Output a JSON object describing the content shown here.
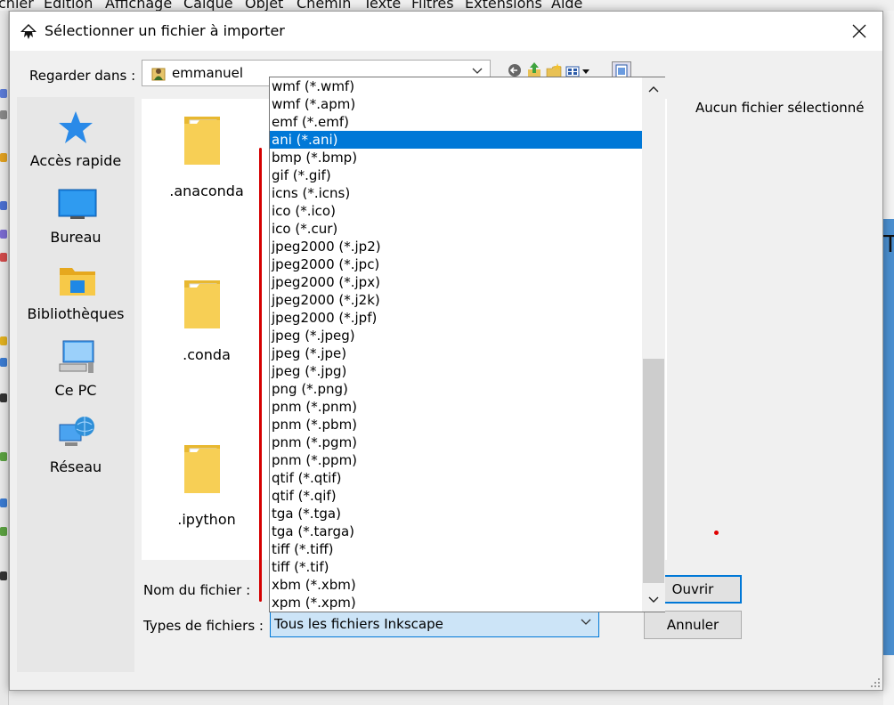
{
  "background_app": {
    "menu": [
      "chier",
      "Édition",
      "Affichage",
      "Calque",
      "Objet",
      "Chemin",
      "Texte",
      "Filtres",
      "Extensions",
      "Aide"
    ],
    "canvas_glyph": "T"
  },
  "dialog": {
    "title": "Sélectionner un fichier à importer",
    "look_in_label": "Regarder dans :",
    "look_in_value": "emmanuel",
    "places": [
      {
        "label": "Accès rapide",
        "icon": "star-icon"
      },
      {
        "label": "Bureau",
        "icon": "desktop-icon"
      },
      {
        "label": "Bibliothèques",
        "icon": "libraries-icon"
      },
      {
        "label": "Ce PC",
        "icon": "computer-icon"
      },
      {
        "label": "Réseau",
        "icon": "network-icon"
      }
    ],
    "folders": [
      ".anaconda",
      ".conda",
      ".ipython"
    ],
    "no_file_selected": "Aucun fichier sélectionné",
    "file_name_label": "Nom du fichier :",
    "file_types_label": "Types de fichiers :",
    "file_types_value": "Tous les fichiers Inkscape",
    "open_button": "Ouvrir",
    "cancel_button": "Annuler",
    "nav_icons": [
      "back-icon",
      "up-folder-icon",
      "new-folder-icon",
      "view-menu-icon",
      "preview-icon"
    ]
  },
  "file_type_dropdown": {
    "selected_index": 3,
    "items": [
      "wmf (*.wmf)",
      "wmf (*.apm)",
      "emf (*.emf)",
      "ani (*.ani)",
      "bmp (*.bmp)",
      "gif (*.gif)",
      "icns (*.icns)",
      "ico (*.ico)",
      "ico (*.cur)",
      "jpeg2000 (*.jp2)",
      "jpeg2000 (*.jpc)",
      "jpeg2000 (*.jpx)",
      "jpeg2000 (*.j2k)",
      "jpeg2000 (*.jpf)",
      "jpeg (*.jpeg)",
      "jpeg (*.jpe)",
      "jpeg (*.jpg)",
      "png (*.png)",
      "pnm (*.pnm)",
      "pnm (*.pbm)",
      "pnm (*.pgm)",
      "pnm (*.ppm)",
      "qtif (*.qtif)",
      "qtif (*.qif)",
      "tga (*.tga)",
      "tga (*.targa)",
      "tiff (*.tiff)",
      "tiff (*.tif)",
      "xbm (*.xbm)",
      "xpm (*.xpm)"
    ]
  },
  "colors": {
    "accent": "#0078d7",
    "annotation_red": "#d40000"
  }
}
